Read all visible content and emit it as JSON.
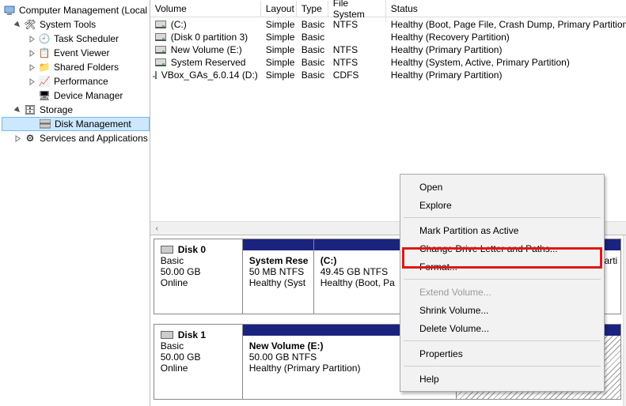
{
  "tree": {
    "root": "Computer Management (Local",
    "system_tools": "System Tools",
    "task_scheduler": "Task Scheduler",
    "event_viewer": "Event Viewer",
    "shared_folders": "Shared Folders",
    "performance": "Performance",
    "device_manager": "Device Manager",
    "storage": "Storage",
    "disk_management": "Disk Management",
    "services_apps": "Services and Applications"
  },
  "columns": {
    "volume": "Volume",
    "layout": "Layout",
    "type": "Type",
    "filesystem": "File System",
    "status": "Status"
  },
  "volumes": [
    {
      "name": "(C:)",
      "layout": "Simple",
      "type": "Basic",
      "fs": "NTFS",
      "status": "Healthy (Boot, Page File, Crash Dump, Primary Partition)"
    },
    {
      "name": "(Disk 0 partition 3)",
      "layout": "Simple",
      "type": "Basic",
      "fs": "",
      "status": "Healthy (Recovery Partition)"
    },
    {
      "name": "New Volume (E:)",
      "layout": "Simple",
      "type": "Basic",
      "fs": "NTFS",
      "status": "Healthy (Primary Partition)"
    },
    {
      "name": "System Reserved",
      "layout": "Simple",
      "type": "Basic",
      "fs": "NTFS",
      "status": "Healthy (System, Active, Primary Partition)"
    },
    {
      "name": "VBox_GAs_6.0.14 (D:)",
      "layout": "Simple",
      "type": "Basic",
      "fs": "CDFS",
      "status": "Healthy (Primary Partition)"
    }
  ],
  "disks": [
    {
      "title": "Disk 0",
      "kind": "Basic",
      "size": "50.00 GB",
      "state": "Online",
      "parts": [
        {
          "title": "System Rese",
          "line2": "50 MB NTFS",
          "line3": "Healthy (Syst",
          "w": 90
        },
        {
          "title": "(C:)",
          "line2": "49.45 GB NTFS",
          "line3": "Healthy (Boot, Pa",
          "w": 145
        },
        {
          "title": "",
          "line2": "",
          "line3": "",
          "w": 0,
          "context": true
        }
      ],
      "tail_title": "",
      "tail_line2": "",
      "tail_line3": "arti"
    },
    {
      "title": "Disk 1",
      "kind": "Basic",
      "size": "50.00 GB",
      "state": "Online",
      "parts": [
        {
          "title": "New Volume  (E:)",
          "line2": "50.00 GB NTFS",
          "line3": "Healthy (Primary Partition)",
          "w": 0
        }
      ]
    }
  ],
  "context_menu": {
    "open": "Open",
    "explore": "Explore",
    "mark_active": "Mark Partition as Active",
    "change_letter": "Change Drive Letter and Paths...",
    "format": "Format...",
    "extend": "Extend Volume...",
    "shrink": "Shrink Volume...",
    "delete": "Delete Volume...",
    "properties": "Properties",
    "help": "Help"
  }
}
